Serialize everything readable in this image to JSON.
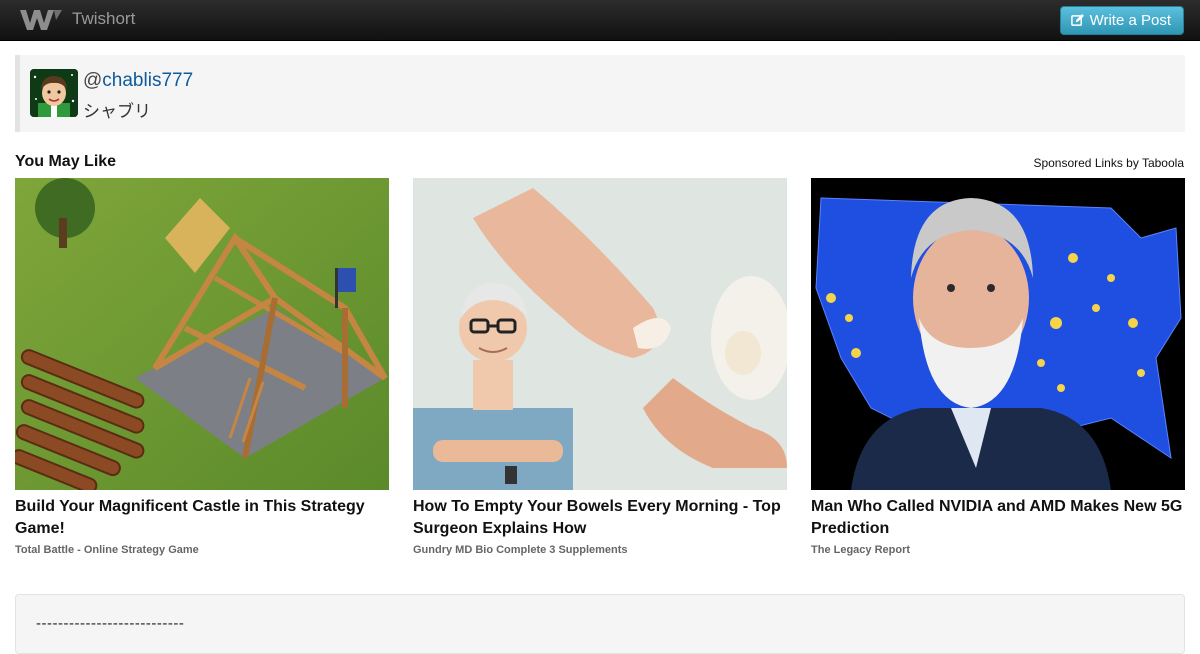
{
  "navbar": {
    "brand": "Twishort",
    "write_button": "Write a Post"
  },
  "profile": {
    "at": "@",
    "username": "chablis777",
    "display_name": "シャブリ"
  },
  "recommendations": {
    "title": "You May Like",
    "sponsored": "Sponsored Links by Taboola",
    "cards": [
      {
        "headline": "Build Your Magnificent Castle in This Strategy Game!",
        "source": "Total Battle - Online Strategy Game"
      },
      {
        "headline": "How To Empty Your Bowels Every Morning - Top Surgeon Explains How",
        "source": "Gundry MD Bio Complete 3 Supplements"
      },
      {
        "headline": "Man Who Called NVIDIA and AMD Makes New 5G Prediction",
        "source": "The Legacy Report"
      }
    ]
  },
  "post": {
    "divider": "---------------------------"
  },
  "colors": {
    "navbar": "#1b1b1b",
    "button": "#49afcd",
    "link": "#0e5a9c"
  }
}
